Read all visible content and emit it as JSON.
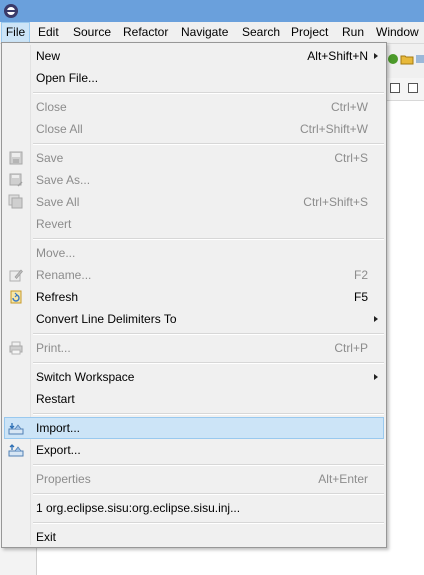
{
  "menubar": {
    "items": [
      {
        "label": "File"
      },
      {
        "label": "Edit"
      },
      {
        "label": "Source"
      },
      {
        "label": "Refactor"
      },
      {
        "label": "Navigate"
      },
      {
        "label": "Search"
      },
      {
        "label": "Project"
      },
      {
        "label": "Run"
      },
      {
        "label": "Window"
      }
    ]
  },
  "file_menu": {
    "new": {
      "label": "New",
      "accel": "Alt+Shift+N"
    },
    "open_file": {
      "label": "Open File..."
    },
    "close": {
      "label": "Close",
      "accel": "Ctrl+W"
    },
    "close_all": {
      "label": "Close All",
      "accel": "Ctrl+Shift+W"
    },
    "save": {
      "label": "Save",
      "accel": "Ctrl+S"
    },
    "save_as": {
      "label": "Save As..."
    },
    "save_all": {
      "label": "Save All",
      "accel": "Ctrl+Shift+S"
    },
    "revert": {
      "label": "Revert"
    },
    "move": {
      "label": "Move..."
    },
    "rename": {
      "label": "Rename...",
      "accel": "F2"
    },
    "refresh": {
      "label": "Refresh",
      "accel": "F5"
    },
    "convert": {
      "label": "Convert Line Delimiters To"
    },
    "print": {
      "label": "Print...",
      "accel": "Ctrl+P"
    },
    "switch_workspace": {
      "label": "Switch Workspace"
    },
    "restart": {
      "label": "Restart"
    },
    "import": {
      "label": "Import..."
    },
    "export": {
      "label": "Export..."
    },
    "properties": {
      "label": "Properties",
      "accel": "Alt+Enter"
    },
    "recent": {
      "label": "1 org.eclipse.sisu:org.eclipse.sisu.inj..."
    },
    "exit": {
      "label": "Exit"
    }
  },
  "colors": {
    "hover": "#cce4f7",
    "disabled_text": "#8c8c8c",
    "titlebar": "#6aa0dc"
  }
}
